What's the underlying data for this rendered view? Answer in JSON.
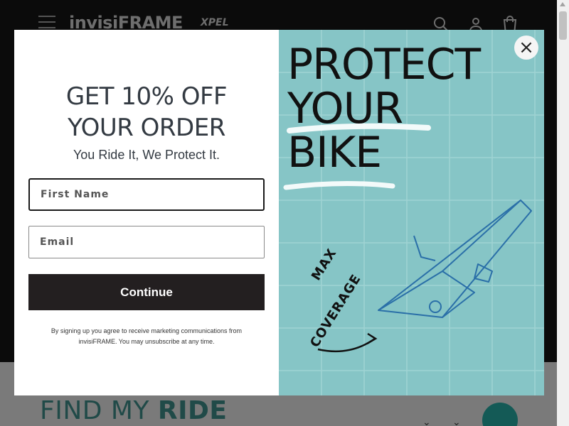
{
  "site": {
    "brand": "invisiFRAME",
    "partner": "XPEL",
    "find_title_light": "FIND MY ",
    "find_title_bold": "RIDE",
    "icons": [
      "menu-icon",
      "search-icon",
      "account-icon",
      "cart-icon"
    ]
  },
  "modal": {
    "headline_line1": "GET 10% OFF",
    "headline_line2": "YOUR ORDER",
    "subhead": "You Ride It, We Protect It.",
    "first_name_placeholder": "First Name",
    "first_name_value": "",
    "email_placeholder": "Email",
    "email_value": "",
    "continue_label": "Continue",
    "disclaimer": "By signing up you agree to receive marketing communications from invisiFRAME. You may unsubscribe at any time.",
    "close_label": "×",
    "hero": {
      "line1": "PROTECT",
      "line2": "YOUR",
      "line3": "BIKE",
      "badge_line1": "MAX",
      "badge_line2": "COVERAGE"
    }
  },
  "colors": {
    "hero_bg": "#86c5c6",
    "button_bg": "#231f20",
    "header_bg": "#0b0b0b",
    "find_accent": "#145a56"
  }
}
